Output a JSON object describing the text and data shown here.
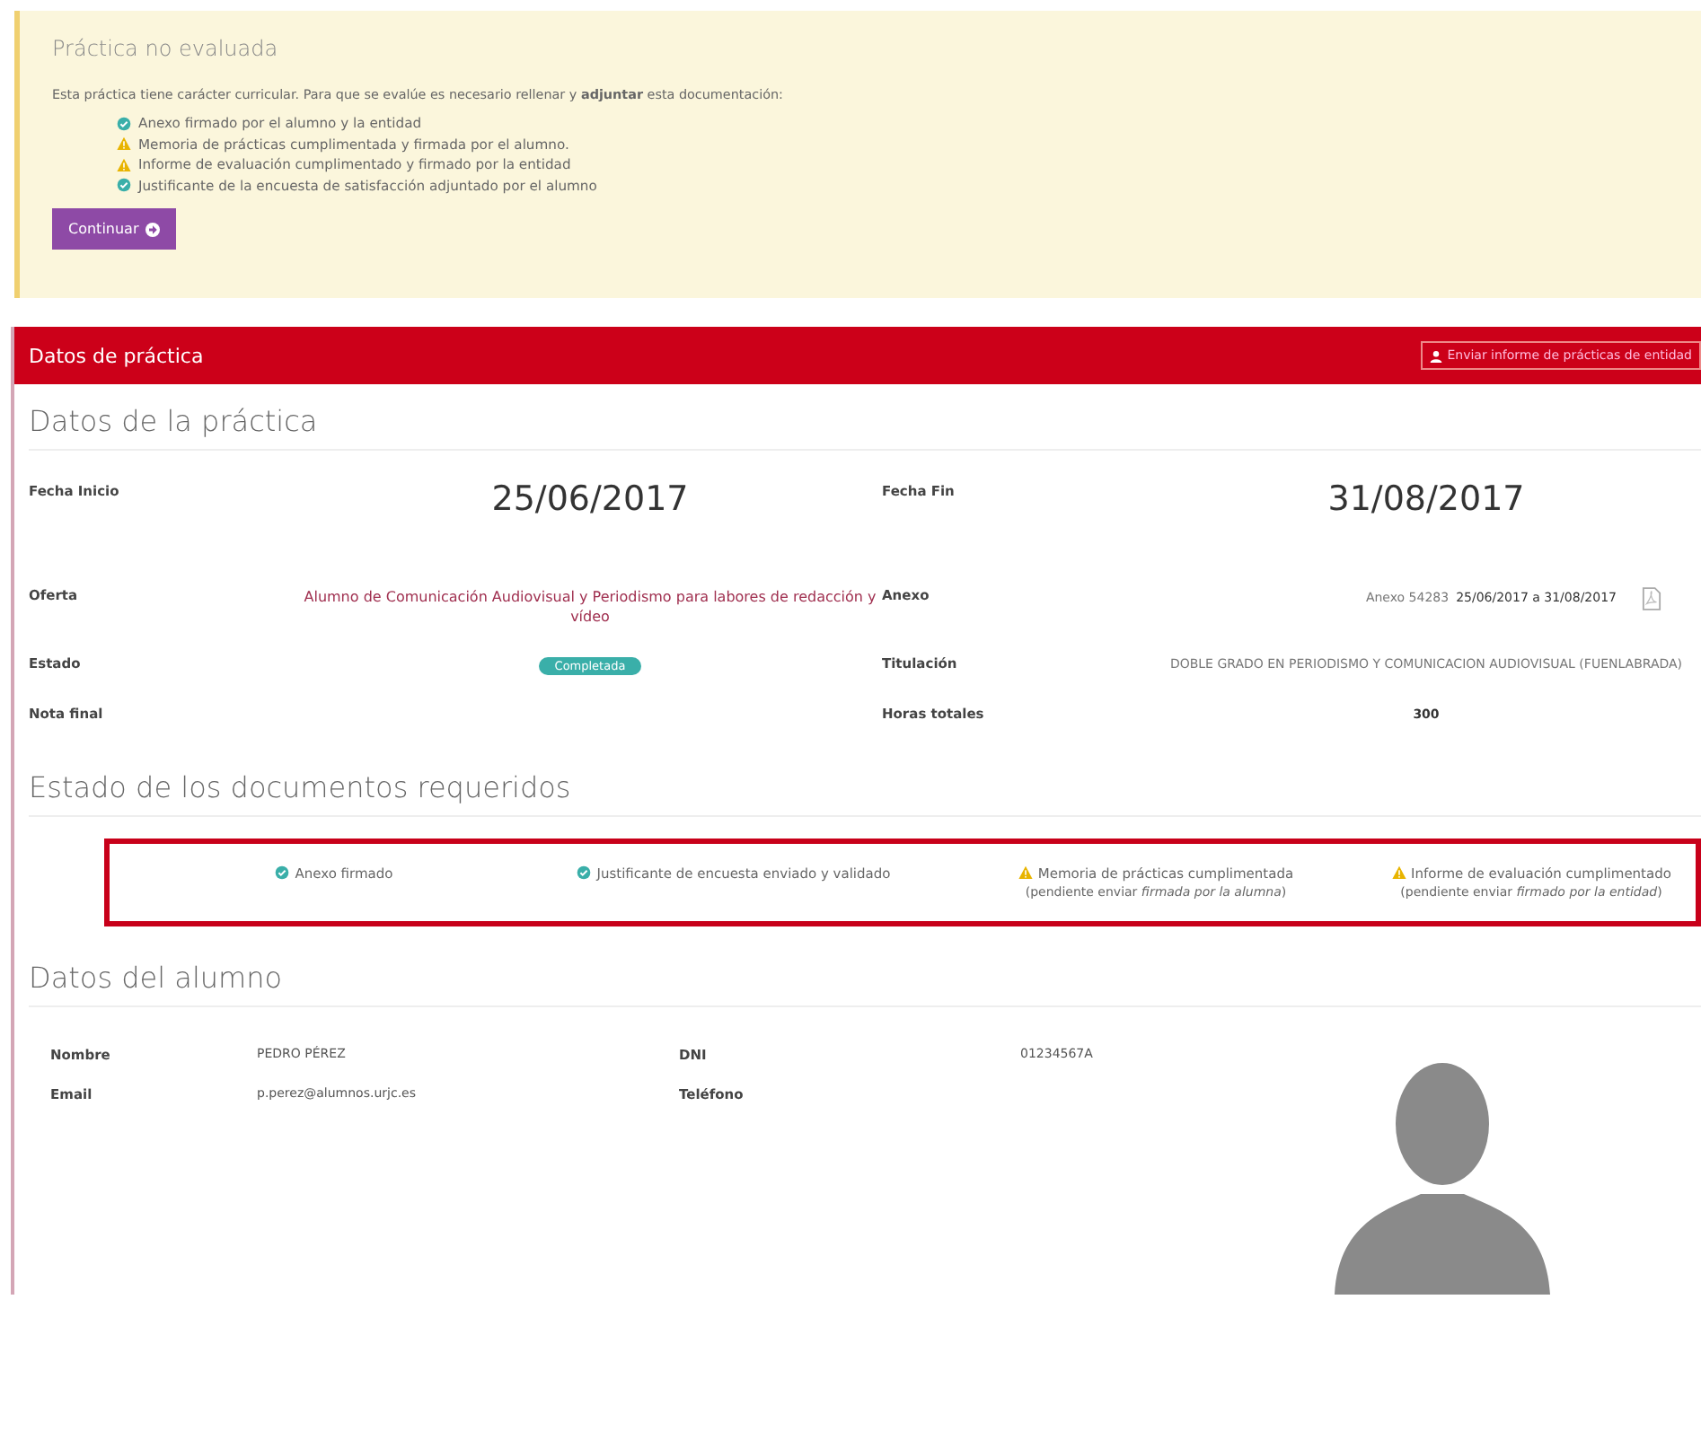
{
  "notice": {
    "title": "Práctica no evaluada",
    "text": "Esta práctica tiene carácter curricular. Para que se evalúe es necesario rellenar y **adjuntar** esta documentación:",
    "items": [
      {
        "kind": "ok",
        "text": "Anexo firmado por el alumno y la entidad"
      },
      {
        "kind": "warning",
        "text": "Memoria de prácticas cumplimentada y firmada por el alumno."
      },
      {
        "kind": "warning",
        "text": "Informe de evaluación cumplimentado y firmado por la entidad"
      },
      {
        "kind": "ok",
        "text": "Justificante de la encuesta de satisfacción adjuntado por el alumno"
      }
    ],
    "button": "Continuar"
  },
  "panel": {
    "title": "Datos de práctica",
    "button": "Enviar informe de prácticas de entidad"
  },
  "practice": {
    "title": "Datos de la práctica",
    "start_label": "Fecha Inicio",
    "start": "25/06/2017",
    "end_label": "Fecha Fin",
    "end": "31/08/2017",
    "offer_label": "Oferta",
    "offer": "Alumno de Comunicación Audiovisual y Periodismo para labores de redacción y vídeo",
    "annex_label": "Anexo",
    "annex": "Anexo 54283",
    "annex_dates": "25/06/2017 a 31/08/2017",
    "status_label": "Estado",
    "status": "Completada",
    "degree_label": "Titulación",
    "degree": "DOBLE GRADO EN PERIODISMO Y COMUNICACION AUDIOVISUAL (FUENLABRADA)",
    "grade_label": "Nota final",
    "hours_label": "Horas totales",
    "hours": "300"
  },
  "documents": {
    "title": "Estado de los documentos requeridos",
    "items": [
      {
        "kind": "ok",
        "text": "Anexo firmado"
      },
      {
        "kind": "ok",
        "text": "Justificante de encuesta enviado y validado"
      },
      {
        "kind": "warning",
        "text": "Memoria de prácticas cumplimentada",
        "note": "(pendiente enviar *firmada por la alumna*)"
      },
      {
        "kind": "warning",
        "text": "Informe de evaluación cumplimentado",
        "note": "(pendiente enviar *firmado por la entidad*)"
      }
    ]
  },
  "student": {
    "title": "Datos del alumno",
    "name_label": "Nombre",
    "name": "PEDRO PÉREZ",
    "dni_label": "DNI",
    "dni": "01234567A",
    "email_label": "Email",
    "email": "p.perez@alumnos.urjc.es",
    "phone_label": "Teléfono"
  }
}
